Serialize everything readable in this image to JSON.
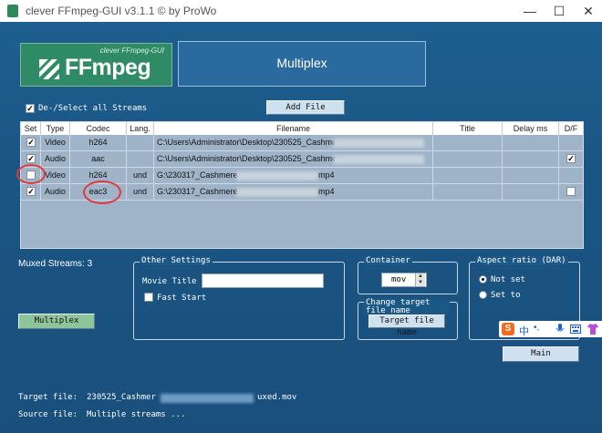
{
  "window": {
    "title": "clever FFmpeg-GUI v3.1.1   © by ProWo",
    "minimize": "—",
    "maximize": "☐",
    "close": "✕"
  },
  "logo": {
    "small_text": "clever FFmpeg-GUI",
    "big_text": "FFmpeg"
  },
  "mode": {
    "label": "Multiplex"
  },
  "streams_toggle": {
    "label": "De-/Select all Streams",
    "checked": true
  },
  "add_file_button": "Add File",
  "table": {
    "headers": [
      "Set",
      "Type",
      "Codec",
      "Lang.",
      "Filename",
      "Title",
      "Delay ms",
      "D/F"
    ],
    "rows": [
      {
        "set": true,
        "type": "Video",
        "codec": "h264",
        "lang": "",
        "filename": "C:\\Users\\Administrator\\Desktop\\230525_Cashmere",
        "df": false,
        "df_visible": false
      },
      {
        "set": true,
        "type": "Audio",
        "codec": "aac",
        "lang": "",
        "filename": "C:\\Users\\Administrator\\Desktop\\230525_Cashmere",
        "df": true,
        "df_visible": true
      },
      {
        "set": false,
        "type": "Video",
        "codec": "h264",
        "lang": "und",
        "filename": "G:\\230317_Cashmere",
        "ext": "mp4",
        "df": false,
        "df_visible": false
      },
      {
        "set": true,
        "type": "Audio",
        "codec": "eac3",
        "lang": "und",
        "filename": "G:\\230317_Cashmere",
        "ext": "mp4",
        "df": false,
        "df_visible": true
      }
    ]
  },
  "muxed_streams": "Muxed Streams:  3",
  "multiplex_button": "Multiplex",
  "other_settings": {
    "legend": "Other Settings",
    "movie_title_label": "Movie Title",
    "movie_title_value": "",
    "fast_start_label": "Fast Start",
    "fast_start_checked": false
  },
  "container": {
    "legend": "Container",
    "value": "mov"
  },
  "change_target": {
    "legend": "Change target file name",
    "button": "Target file name"
  },
  "aspect": {
    "legend": "Aspect ratio (DAR)",
    "options": [
      "Not set",
      "Set to"
    ],
    "selected": "Not set"
  },
  "main_button": "Main",
  "ime": {
    "logo": "S",
    "label": "中"
  },
  "target_file": {
    "label": "Target file:",
    "value_start": "230525_Cashmer",
    "value_end": "uxed.mov"
  },
  "source_file": {
    "label": "Source file:",
    "value": "Multiple streams ..."
  },
  "colors": {
    "background": "#1f5b8c",
    "logo_green": "#2f8a66",
    "highlight_red": "#e23a3a"
  }
}
